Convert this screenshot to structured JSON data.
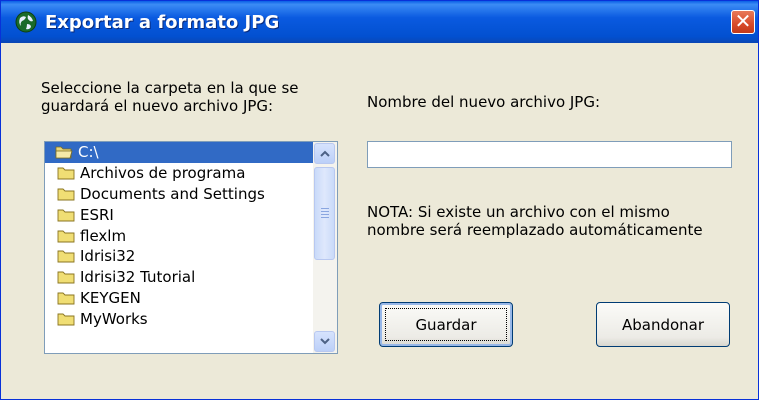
{
  "window": {
    "title": "Exportar a formato JPG",
    "close_glyph": "✕",
    "title_icon": "globe-icon",
    "title_bar_color": "#0a5ae0"
  },
  "folder_panel": {
    "label_line1": "Seleccione la carpeta en la que se",
    "label_line2": "guardará el nuevo archivo JPG:",
    "items": [
      {
        "label": "C:\\",
        "selected": true
      },
      {
        "label": "Archivos de programa"
      },
      {
        "label": "Documents and Settings"
      },
      {
        "label": "ESRI"
      },
      {
        "label": "flexlm"
      },
      {
        "label": "Idrisi32"
      },
      {
        "label": "Idrisi32 Tutorial"
      },
      {
        "label": "KEYGEN"
      },
      {
        "label": "MyWorks"
      }
    ]
  },
  "filename": {
    "label": "Nombre del nuevo archivo JPG:",
    "value": ""
  },
  "note": {
    "line1": "NOTA: Si existe un archivo con el mismo",
    "line2": "nombre será reemplazado automáticamente"
  },
  "buttons": {
    "save": "Guardar",
    "cancel": "Abandonar"
  },
  "colors": {
    "selection": "#316ac5",
    "dialog_bg": "#ece9d8",
    "close_button": "#d84a2a"
  }
}
